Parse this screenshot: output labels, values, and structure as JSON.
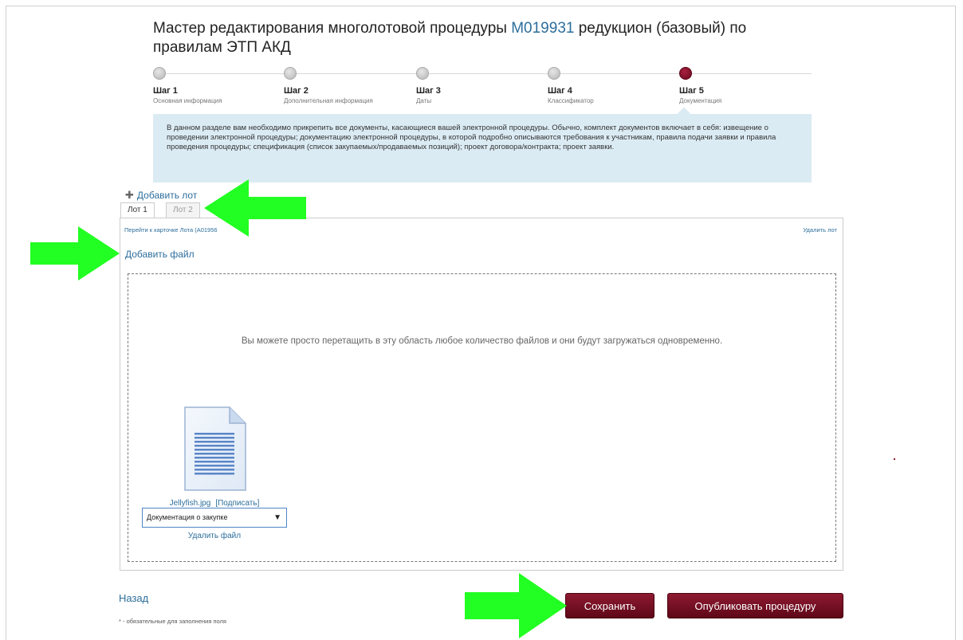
{
  "wizard": {
    "title_before": "Мастер редактирования многолотовой процедуры ",
    "procedure_number": "M019931",
    "title_after": " редукцион (базовый) по правилам ЭТП АКД"
  },
  "steps": [
    {
      "label": "Шаг 1",
      "desc": "Основная информация"
    },
    {
      "label": "Шаг 2",
      "desc": "Дополнительная информация"
    },
    {
      "label": "Шаг 3",
      "desc": "Даты"
    },
    {
      "label": "Шаг 4",
      "desc": "Классификатор"
    },
    {
      "label": "Шаг 5",
      "desc": "Документация"
    }
  ],
  "info_text": "В данном разделе вам необходимо прикрепить все документы, касающиеся вашей электронной процедуры. Обычно, комплект документов включает в себя: извещение о проведении электронной процедуры; документацию электронной процедуры, в которой подробно описываются требования к участникам, правила подачи заявки и правила проведения процедуры; спецификация (список закупаемых/продаваемых позиций); проект договора/контракта; проект заявки.",
  "lots": {
    "add_lot": "Добавить лот",
    "tabs": [
      "Лот 1",
      "Лот 2"
    ],
    "lot_card_link": "Перейти к карточке Лота (A01956",
    "delete_lot": "Удалить лот"
  },
  "files": {
    "add_file": "Добавить файл",
    "drop_hint": "Вы можете просто перетащить в эту область любое количество файлов и они будут загружаться одновременно.",
    "file_name": "Jellyfish.jpg",
    "sign_label": "[Подписать]",
    "doc_type": "Документация о закупке",
    "delete_file": "Удалить файл"
  },
  "footer": {
    "back": "Назад",
    "required_note": "* - обязательные для заполнения поля",
    "save": "Сохранить",
    "publish": "Опубликовать процедуру"
  },
  "colors": {
    "accent": "#6a0a1e",
    "link": "#2d6e9c",
    "info_bg": "#dbebf4",
    "annotation_arrow": "#22ff22"
  }
}
